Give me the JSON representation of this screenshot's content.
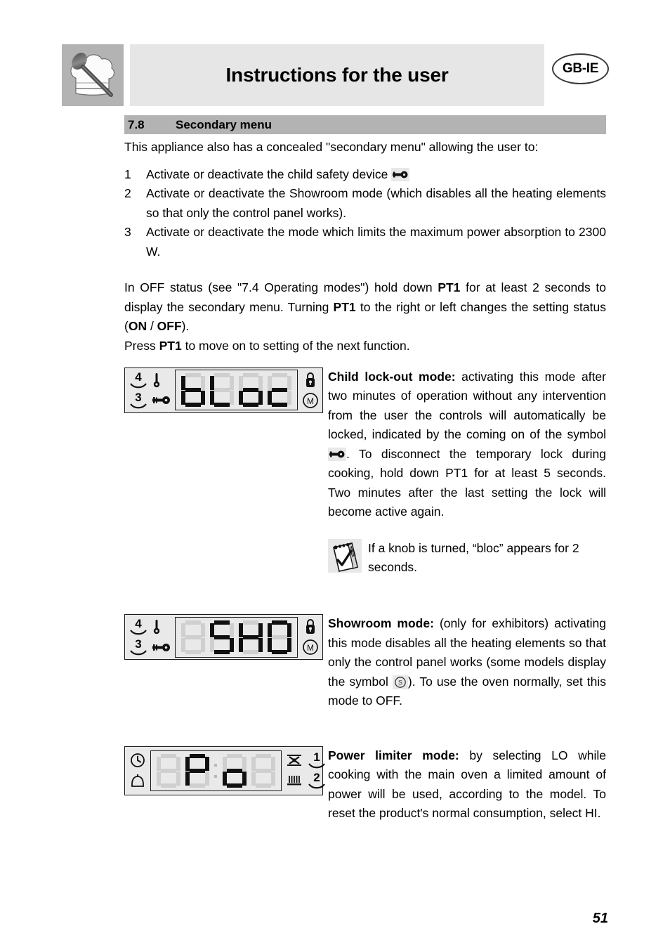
{
  "header": {
    "title": "Instructions for the user",
    "language_badge": "GB-IE",
    "logo_alt": "chef-hat-and-spoon"
  },
  "section": {
    "number": "7.8",
    "title": "Secondary menu"
  },
  "intro": {
    "paragraph": "This appliance also has a concealed \"secondary menu\" allowing the user to:",
    "items": [
      {
        "num": "1",
        "text": "Activate or deactivate the child safety device ",
        "symbol": "key-icon"
      },
      {
        "num": "2",
        "text": "Activate or deactivate the Showroom mode (which disables all the heating elements so that only the control panel works)."
      },
      {
        "num": "3",
        "text": "Activate or deactivate the mode which limits the maximum power absorption to 2300 W."
      }
    ]
  },
  "operation": {
    "line1_a": "In OFF status (see \"7.4 Operating modes\") hold down ",
    "line1_b": "PT1",
    "line1_c": " for at least 2 seconds to display the secondary menu. Turning ",
    "line1_d": "PT1",
    "line1_e": " to the right or left changes the setting status (",
    "line1_f": "ON",
    "line1_g": " / ",
    "line1_h": "OFF",
    "line1_i": ").",
    "line2_a": "Press ",
    "line2_b": "PT1",
    "line2_c": " to move on to setting of the next function."
  },
  "displays": {
    "child_lock": {
      "digits": [
        {
          "char": "b",
          "segments": [
            "f",
            "g",
            "e",
            "d",
            "c"
          ]
        },
        {
          "char": "L",
          "segments": [
            "f",
            "e",
            "d"
          ]
        },
        {
          "char": "o",
          "segments": [
            "g",
            "e",
            "d",
            "c"
          ]
        },
        {
          "char": "c",
          "segments": [
            "g",
            "e",
            "d"
          ]
        }
      ],
      "left_icons": [
        "pan-4-icon",
        "thermometer-icon",
        "pan-3-icon",
        "key-icon"
      ],
      "right_icons": [
        "padlock-icon",
        "memory-m-icon"
      ],
      "pan_top_label": "4",
      "pan_bottom_label": "3"
    },
    "showroom": {
      "digits": [
        {
          "char": " ",
          "segments": []
        },
        {
          "char": "S",
          "segments": [
            "a",
            "f",
            "g",
            "c",
            "d"
          ]
        },
        {
          "char": "H",
          "segments": [
            "f",
            "b",
            "g",
            "e",
            "c"
          ]
        },
        {
          "char": "O",
          "segments": [
            "a",
            "f",
            "b",
            "e",
            "c",
            "d"
          ]
        }
      ],
      "left_icons": [
        "pan-4-icon",
        "thermometer-icon",
        "pan-3-icon",
        "key-icon"
      ],
      "right_icons": [
        "padlock-icon",
        "memory-m-icon"
      ],
      "pan_top_label": "4",
      "pan_bottom_label": "3"
    },
    "power_limiter": {
      "digits": [
        {
          "char": " ",
          "segments": []
        },
        {
          "char": "P",
          "segments": [
            "a",
            "f",
            "b",
            "g",
            "e"
          ]
        },
        {
          "char": "o",
          "segments": [
            "g",
            "e",
            "d",
            "c"
          ]
        },
        {
          "char": " ",
          "segments": []
        }
      ],
      "left_icons": [
        "clock-icon",
        "bell-icon"
      ],
      "right_icons": [
        "fan-crossed-icon",
        "heating-element-icon",
        "zone-1-icon",
        "zone-2-icon"
      ],
      "zone_top_label": "1",
      "zone_bottom_label": "2"
    }
  },
  "descriptions": {
    "child_lock": {
      "title": "Child lock-out mode:",
      "body_a": " activating this mode after two minutes of operation without any intervention from the user the controls will automatically be locked, indicated by the coming on of the symbol ",
      "symbol": "key-icon",
      "body_b": ". To disconnect the temporary lock during cooking, hold down PT1 for at least 5 seconds. Two minutes after the last setting the lock will become active again."
    },
    "note": {
      "icon": "notepad-check-icon",
      "text": "If a knob is turned, “bloc” appears for 2 seconds."
    },
    "showroom": {
      "title": "Showroom mode:",
      "body_a": " (only for exhibitors) activating this mode disables all the heating elements so that only the control panel works (some models display the symbol ",
      "symbol": "circle-s-icon",
      "body_b": "). To use the oven normally, set this mode to OFF."
    },
    "power_limiter": {
      "title": "Power limiter mode:",
      "body": " by selecting LO while cooking with the main oven a limited amount of power will be used, according to the model. To reset the product's normal consumption, select HI."
    }
  },
  "footer": {
    "page_number": "51"
  },
  "colors": {
    "header_bar": "#e6e6e6",
    "logo_bg": "#b3b3b3",
    "section_bar": "#b3b3b3",
    "lcd_bg": "#e9e9e9",
    "segment_on": "#101010",
    "segment_off": "#cfcfcf"
  }
}
